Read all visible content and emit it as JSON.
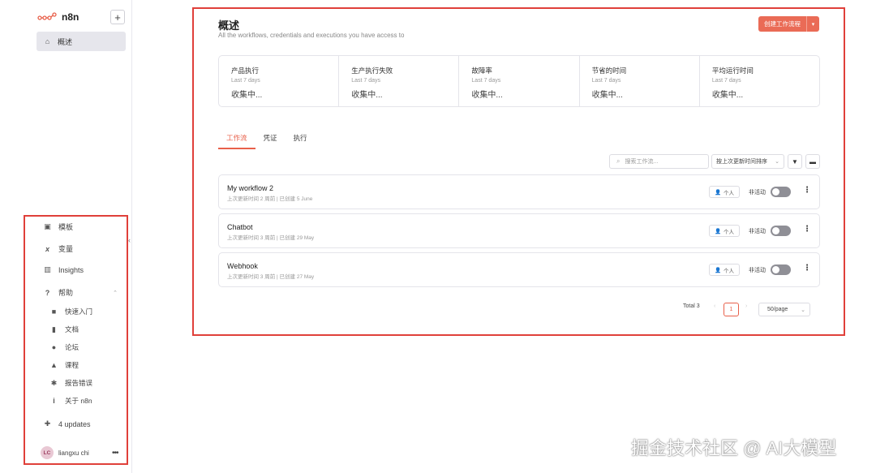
{
  "sidebar": {
    "brand": "n8n",
    "add_label": "+",
    "overview_label": "概述",
    "items": [
      {
        "label": "模板",
        "icon": "box-icon"
      },
      {
        "label": "变量",
        "icon": "variable-icon"
      },
      {
        "label": "Insights",
        "icon": "chart-icon"
      },
      {
        "label": "帮助",
        "icon": "question-icon"
      }
    ],
    "help_items": [
      {
        "label": "快速入门",
        "icon": "video-icon"
      },
      {
        "label": "文档",
        "icon": "book-icon"
      },
      {
        "label": "论坛",
        "icon": "users-icon"
      },
      {
        "label": "课程",
        "icon": "graduation-icon"
      },
      {
        "label": "报告错误",
        "icon": "bug-icon"
      },
      {
        "label": "关于 n8n",
        "icon": "info-icon"
      }
    ],
    "updates_label": "4 updates",
    "user_initials": "LC",
    "user_name": "liangxu chi",
    "user_more": "•••"
  },
  "header": {
    "title": "概述",
    "subtitle": "All the workflows, credentials and executions you have access to",
    "create_label": "创建工作流程"
  },
  "stats": [
    {
      "name": "产品执行",
      "period": "Last 7 days",
      "value": "收集中..."
    },
    {
      "name": "生产执行失败",
      "period": "Last 7 days",
      "value": "收集中..."
    },
    {
      "name": "故障率",
      "period": "Last 7 days",
      "value": "收集中..."
    },
    {
      "name": "节省的时间",
      "period": "Last 7 days",
      "value": "收集中..."
    },
    {
      "name": "平均运行时间",
      "period": "Last 7 days",
      "value": "收集中..."
    }
  ],
  "tabs": [
    "工作流",
    "凭证",
    "执行"
  ],
  "search": {
    "placeholder": "搜索工作流..."
  },
  "sort_label": "按上次更新时间排序",
  "workflows": [
    {
      "name": "My workflow 2",
      "meta": "上次更新时间 2 周前 | 已创建 5 June",
      "owner": "个人",
      "status": "非活动"
    },
    {
      "name": "Chatbot",
      "meta": "上次更新时间 3 周前 | 已创建 29 May",
      "owner": "个人",
      "status": "非活动"
    },
    {
      "name": "Webhook",
      "meta": "上次更新时间 3 周前 | 已创建 27 May",
      "owner": "个人",
      "status": "非活动"
    }
  ],
  "pagination": {
    "total": "Total 3",
    "current": "1",
    "per_page": "50/page"
  },
  "watermark": "掘金技术社区 @ AI大模型"
}
